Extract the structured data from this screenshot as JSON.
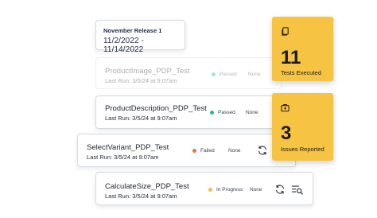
{
  "release": {
    "title": "November Release 1",
    "dates": "11/2/2022 - 11/14/2022"
  },
  "tests": [
    {
      "name": "ProductImage_PDP_Test",
      "last_run": "Last Run: 3/5/24 at 9:07am",
      "status": "Passed",
      "status_color": "#2bb39a",
      "assignee": "None"
    },
    {
      "name": "ProductDescription_PDP_Test",
      "last_run": "Last Run: 3/5/24 at 9:07am",
      "status": "Passed",
      "status_color": "#2bb39a",
      "assignee": "None"
    },
    {
      "name": "SelectVariant_PDP_Test",
      "last_run": "Last Run: 3/5/24 at 9:07am",
      "status": "Failed",
      "status_color": "#e8763a",
      "assignee": "None"
    },
    {
      "name": "CalculateSize_PDP_Test",
      "last_run": "Last Run: 3/5/24 at 9:07am",
      "status": "In Progress",
      "status_color": "#f2c046",
      "assignee": "None"
    }
  ],
  "stats": {
    "tests_executed": {
      "value": "11",
      "label": "Tests Executed",
      "icon": "document-icon"
    },
    "issues_reported": {
      "value": "3",
      "label": "Issues Reported",
      "icon": "briefcase-icon"
    }
  },
  "colors": {
    "accent": "#f6c342",
    "passed": "#2bb39a",
    "failed": "#e8763a",
    "in_progress": "#f2c046"
  }
}
